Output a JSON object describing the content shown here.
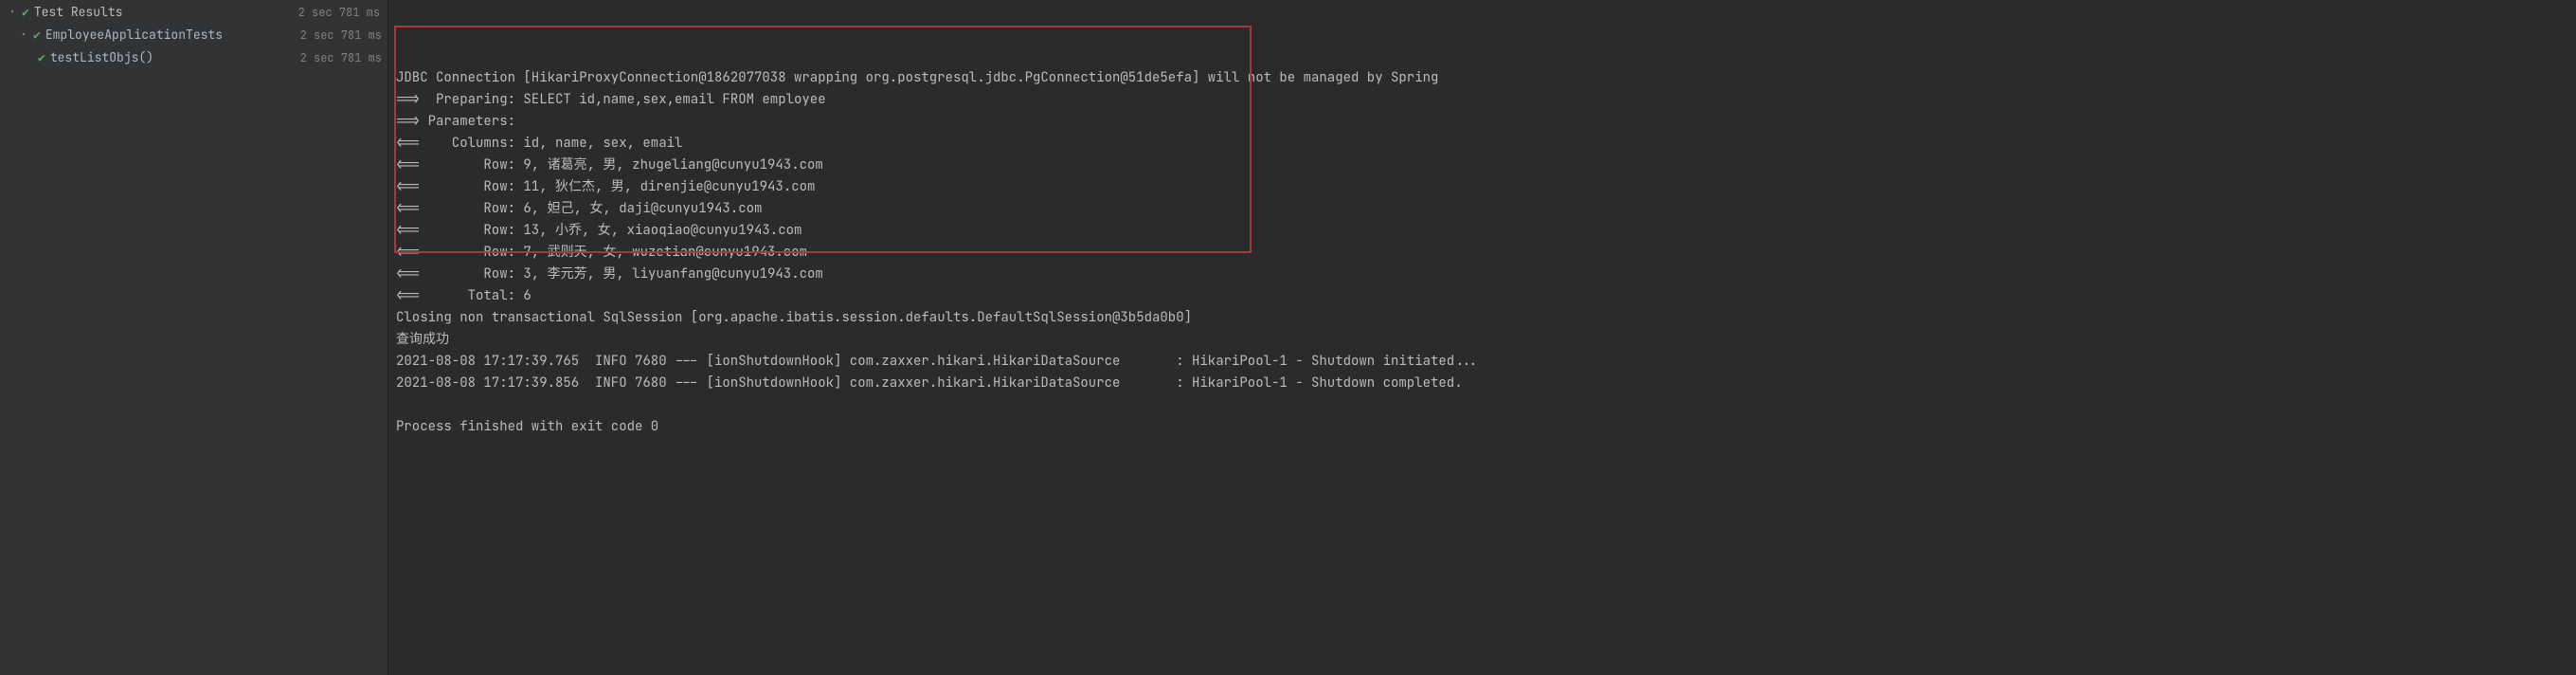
{
  "left_panel": {
    "header": {
      "title": "Test Results",
      "time": "2 sec 781 ms"
    },
    "items": [
      {
        "label": "EmployeeApplicationTests",
        "time": "2 sec 781 ms",
        "indent": 1,
        "chevron": true,
        "check": true
      },
      {
        "label": "testListObjs()",
        "time": "2 sec 781 ms",
        "indent": 2,
        "chevron": false,
        "check": true
      }
    ]
  },
  "console": {
    "lines": [
      "JDBC Connection [HikariProxyConnection@1862077038 wrapping org.postgresql.jdbc.PgConnection@51de5efa] will not be managed by Spring",
      "==>  Preparing: SELECT id,name,sex,email FROM employee",
      "==> Parameters:",
      "<==    Columns: id, name, sex, email",
      "<==        Row: 9, 诸葛亮, 男, zhugeliang@cunyu1943.com",
      "<==        Row: 11, 狄仁杰, 男, direnjie@cunyu1943.com",
      "<==        Row: 6, 妲己, 女, daji@cunyu1943.com",
      "<==        Row: 13, 小乔, 女, xiaoqiao@cunyu1943.com",
      "<==        Row: 7, 武则天, 女, wuzetian@cunyu1943.com",
      "<==        Row: 3, 李元芳, 男, liyuanfang@cunyu1943.com",
      "<==      Total: 6",
      "Closing non transactional SqlSession [org.apache.ibatis.session.defaults.DefaultSqlSession@3b5da0b0]",
      "查询成功",
      "2021-08-08 17:17:39.765  INFO 7680 --- [ionShutdownHook] com.zaxxer.hikari.HikariDataSource       : HikariPool-1 - Shutdown initiated...",
      "2021-08-08 17:17:39.856  INFO 7680 --- [ionShutdownHook] com.zaxxer.hikari.HikariDataSource       : HikariPool-1 - Shutdown completed.",
      "",
      "Process finished with exit code 0"
    ]
  }
}
